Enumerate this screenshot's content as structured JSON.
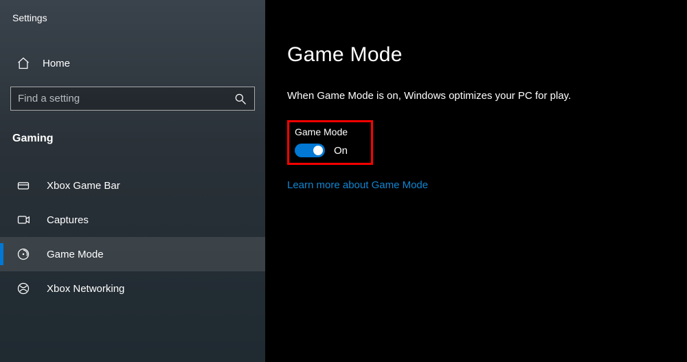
{
  "app_title": "Settings",
  "home_label": "Home",
  "search": {
    "placeholder": "Find a setting"
  },
  "section_label": "Gaming",
  "nav": [
    {
      "key": "xbox-game-bar",
      "label": "Xbox Game Bar",
      "selected": false
    },
    {
      "key": "captures",
      "label": "Captures",
      "selected": false
    },
    {
      "key": "game-mode",
      "label": "Game Mode",
      "selected": true
    },
    {
      "key": "xbox-networking",
      "label": "Xbox Networking",
      "selected": false
    }
  ],
  "page": {
    "title": "Game Mode",
    "description": "When Game Mode is on, Windows optimizes your PC for play.",
    "toggle_label": "Game Mode",
    "toggle_state": "On",
    "learn_more": "Learn more about Game Mode"
  }
}
